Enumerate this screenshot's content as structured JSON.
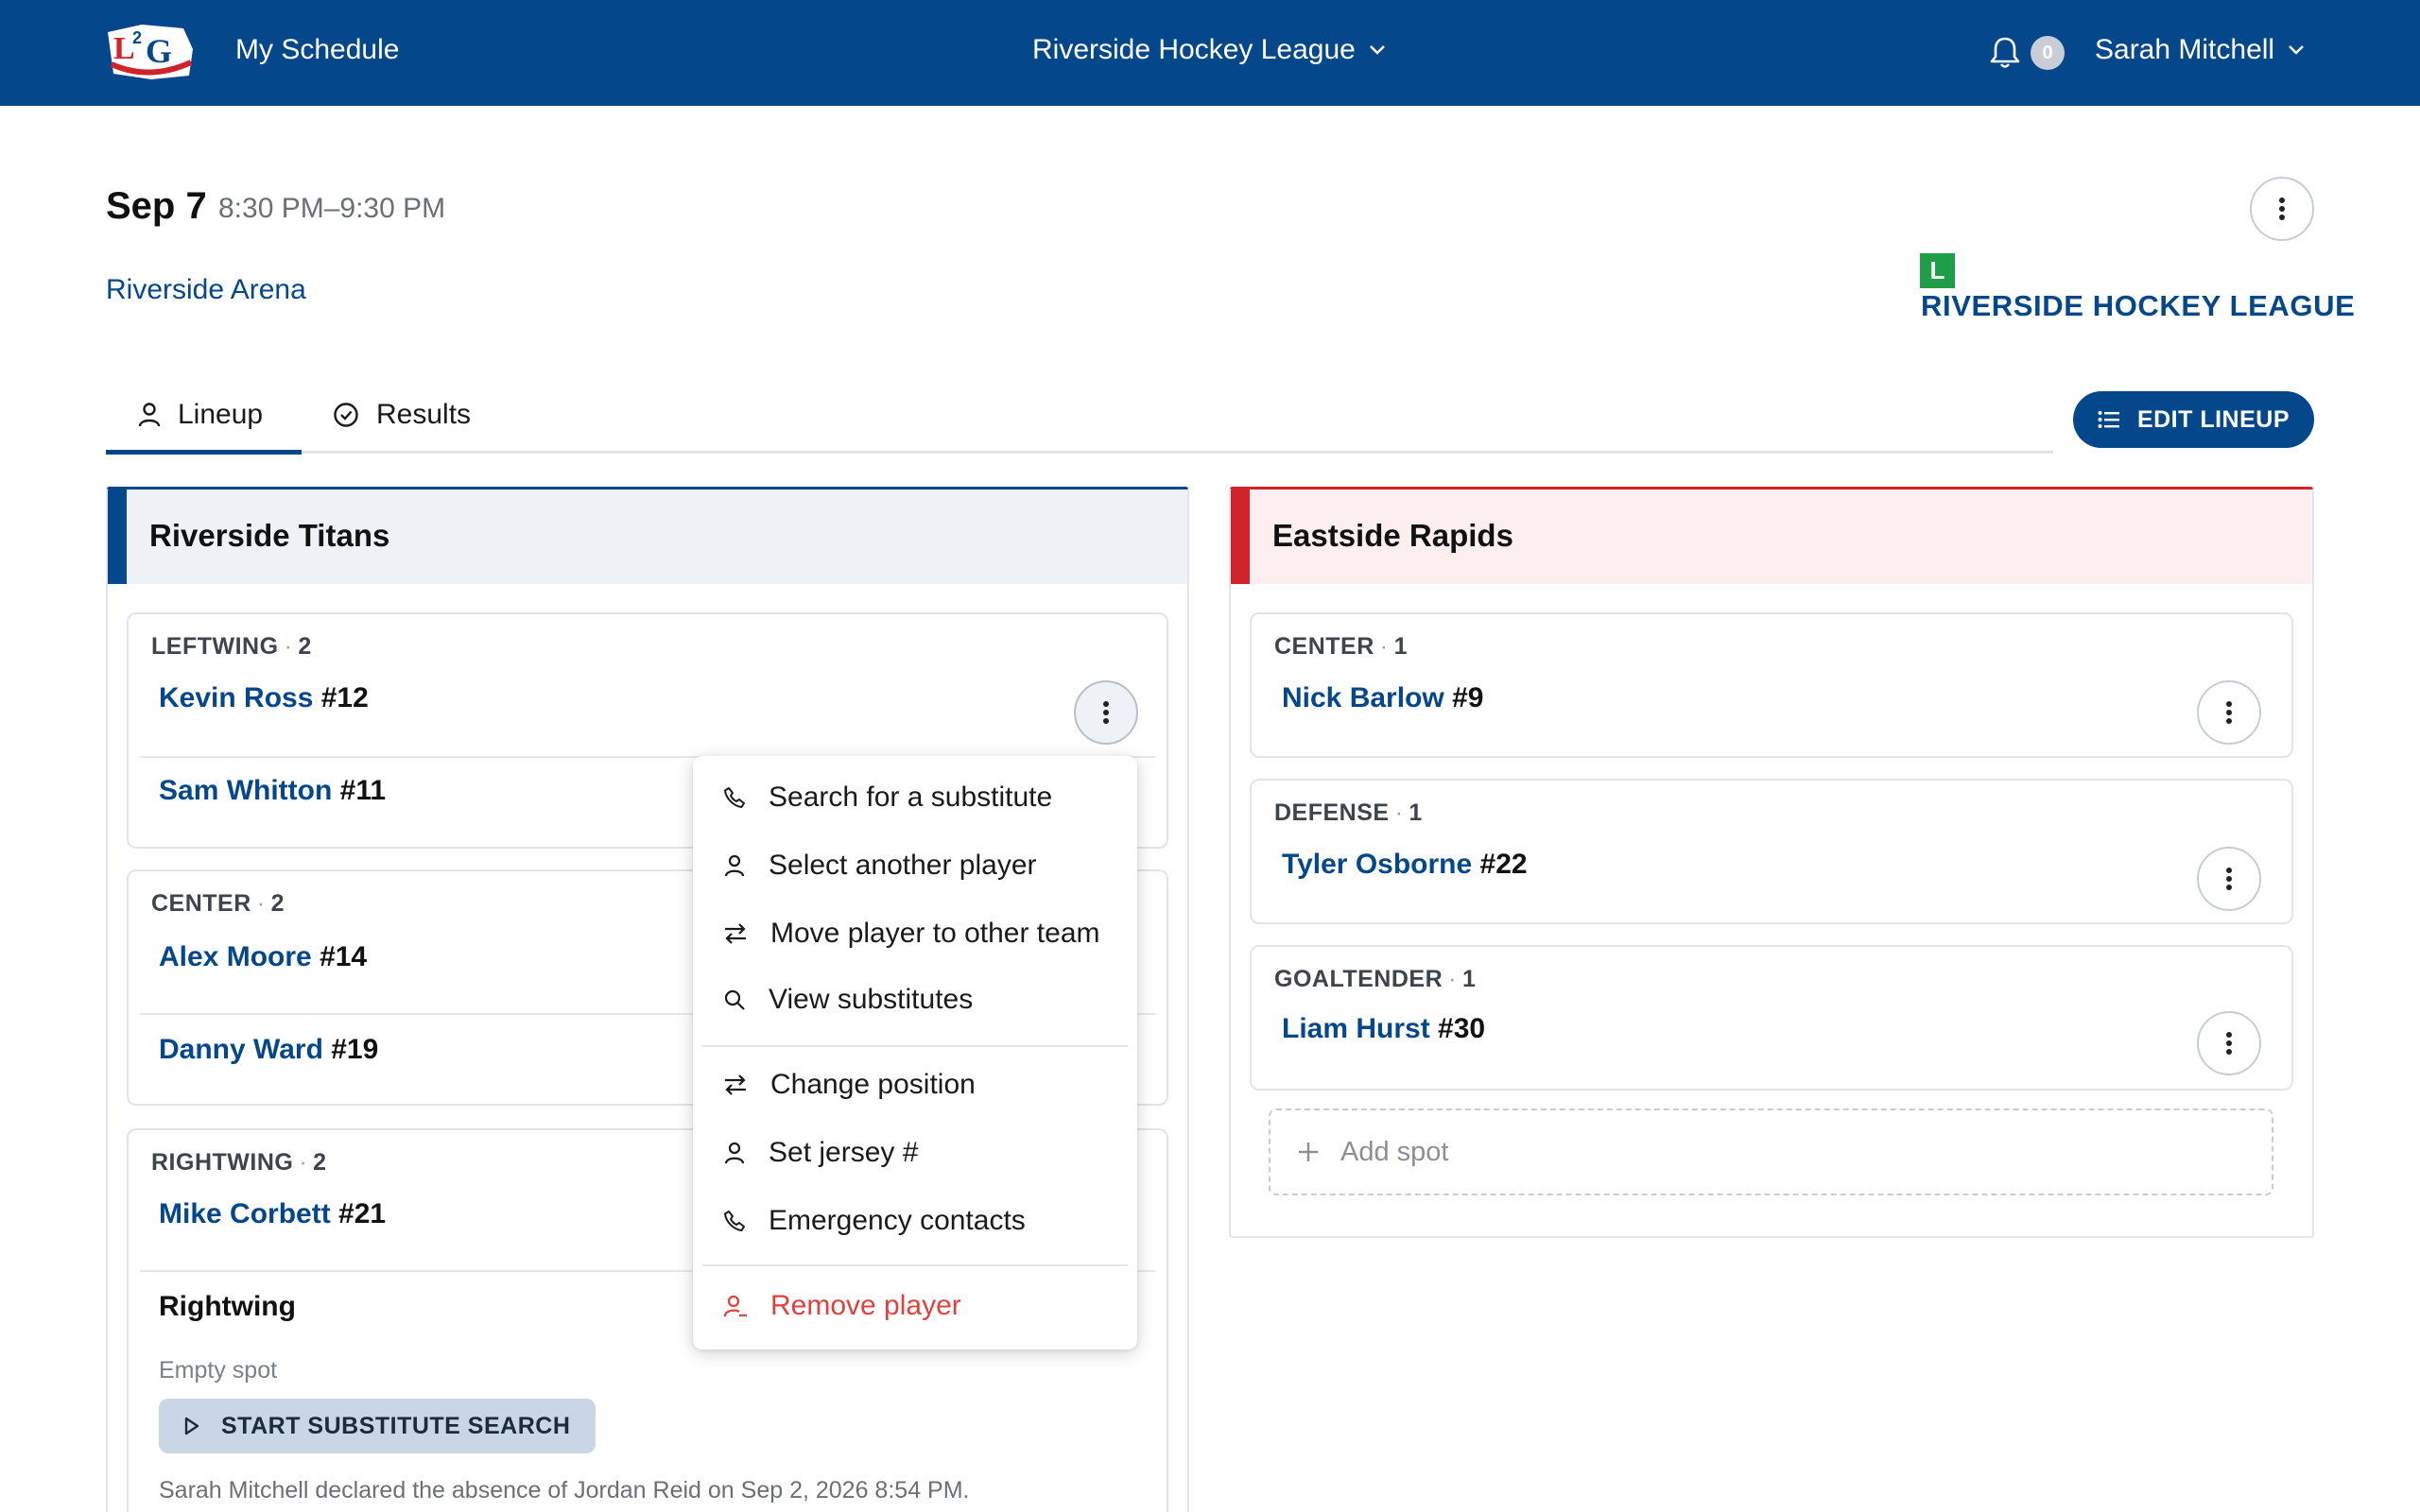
{
  "topbar": {
    "logo_text": "L2G",
    "nav_schedule": "My Schedule",
    "league_switcher": "Riverside Hockey League",
    "notification_count": "0",
    "user_name": "Sarah Mitchell"
  },
  "event": {
    "date": "Sep 7",
    "time": "8:30 PM–9:30 PM",
    "venue": "Riverside Arena",
    "league_badge": "L",
    "league_name": "RIVERSIDE HOCKEY LEAGUE"
  },
  "tabs": [
    {
      "label": "Lineup",
      "icon": "person-icon",
      "active": true
    },
    {
      "label": "Results",
      "icon": "check-circle-icon",
      "active": false
    }
  ],
  "edit_lineup_label": "EDIT LINEUP",
  "home_team": {
    "name": "Riverside Titans",
    "color": "#05478b",
    "positions": [
      {
        "label": "LEFTWING",
        "count": "2",
        "players": [
          {
            "name": "Kevin Ross",
            "number": "#12"
          },
          {
            "name": "Sam Whitton",
            "number": "#11"
          }
        ]
      },
      {
        "label": "CENTER",
        "count": "2",
        "players": [
          {
            "name": "Alex Moore",
            "number": "#14"
          },
          {
            "name": "Danny Ward",
            "number": "#19"
          }
        ]
      },
      {
        "label": "RIGHTWING",
        "count": "2",
        "players": [
          {
            "name": "Mike Corbett",
            "number": "#21"
          }
        ],
        "empty_spot": {
          "title": "Rightwing",
          "status": "Empty spot",
          "button": "START SUBSTITUTE SEARCH",
          "note": "Sarah Mitchell declared the absence of Jordan Reid on Sep 2, 2026 8:54 PM."
        }
      }
    ]
  },
  "away_team": {
    "name": "Eastside Rapids",
    "color": "#d0232a",
    "positions": [
      {
        "label": "CENTER",
        "count": "1",
        "players": [
          {
            "name": "Nick Barlow",
            "number": "#9"
          }
        ]
      },
      {
        "label": "DEFENSE",
        "count": "1",
        "players": [
          {
            "name": "Tyler Osborne",
            "number": "#22"
          }
        ]
      },
      {
        "label": "GOALTENDER",
        "count": "1",
        "players": [
          {
            "name": "Liam Hurst",
            "number": "#30"
          }
        ]
      }
    ],
    "add_spot_label": "Add spot"
  },
  "player_menu": {
    "items": [
      {
        "label": "Search for a substitute",
        "icon": "phone-icon"
      },
      {
        "label": "Select another player",
        "icon": "person-icon"
      },
      {
        "label": "Move player to other team",
        "icon": "swap-icon"
      },
      {
        "label": "View substitutes",
        "icon": "search-icon"
      },
      {
        "label": "Change position",
        "icon": "swap-icon"
      },
      {
        "label": "Set jersey #",
        "icon": "person-icon"
      },
      {
        "label": "Emergency contacts",
        "icon": "phone-icon"
      },
      {
        "label": "Remove player",
        "icon": "remove-person-icon",
        "danger": true
      }
    ]
  }
}
